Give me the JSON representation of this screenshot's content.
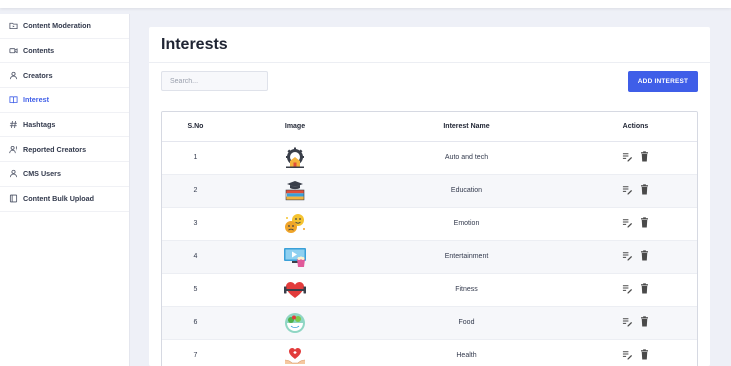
{
  "sidebar": {
    "items": [
      {
        "label": "Content Moderation",
        "icon": "folder-video-icon"
      },
      {
        "label": "Contents",
        "icon": "video-camera-icon"
      },
      {
        "label": "Creators",
        "icon": "user-icon"
      },
      {
        "label": "Interest",
        "icon": "book-icon",
        "active": true
      },
      {
        "label": "Hashtags",
        "icon": "hashtag-icon"
      },
      {
        "label": "Reported Creators",
        "icon": "user-report-icon"
      },
      {
        "label": "CMS Users",
        "icon": "user-icon"
      },
      {
        "label": "Content Bulk Upload",
        "icon": "upload-icon"
      }
    ]
  },
  "page": {
    "title": "Interests",
    "search_placeholder": "Search...",
    "add_button": "ADD INTEREST"
  },
  "table": {
    "headers": [
      "S.No",
      "Image",
      "Interest Name",
      "Actions"
    ],
    "rows": [
      {
        "sno": "1",
        "name": "Auto and tech",
        "image_icon": "gear-house-icon"
      },
      {
        "sno": "2",
        "name": "Education",
        "image_icon": "books-graduation-icon"
      },
      {
        "sno": "3",
        "name": "Emotion",
        "image_icon": "emoji-faces-icon"
      },
      {
        "sno": "4",
        "name": "Entertainment",
        "image_icon": "screen-popcorn-icon"
      },
      {
        "sno": "5",
        "name": "Fitness",
        "image_icon": "heart-dumbbell-icon"
      },
      {
        "sno": "6",
        "name": "Food",
        "image_icon": "salad-bowl-icon"
      },
      {
        "sno": "7",
        "name": "Health",
        "image_icon": "heart-hands-icon"
      }
    ],
    "action_icons": [
      "edit-icon",
      "delete-icon"
    ]
  },
  "colors": {
    "accent": "#3f5ee8",
    "background": "#eef0f7",
    "stripe": "#f6f7fa"
  }
}
